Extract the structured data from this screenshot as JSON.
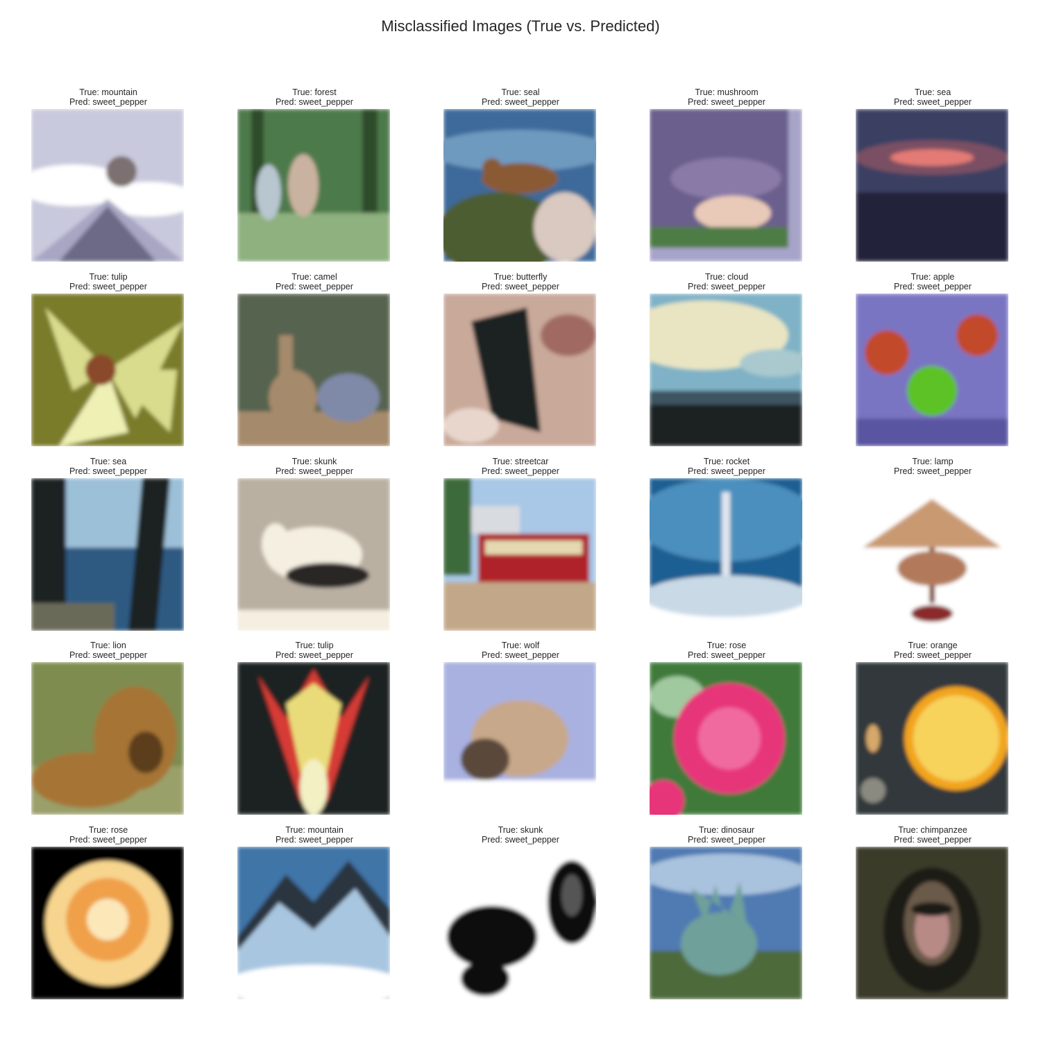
{
  "title": "Misclassified Images (True vs. Predicted)",
  "images": [
    {
      "true_label": "True: mountain",
      "pred_label": "Pred: sweet_pepper",
      "subject": "snowy-mountain-ridge",
      "palette": [
        "#c9c9dd",
        "#ffffff",
        "#6c6a86",
        "#a7a6c3"
      ]
    },
    {
      "true_label": "True: forest",
      "pred_label": "Pred: sweet_pepper",
      "subject": "people-in-forest",
      "palette": [
        "#4e7a4b",
        "#8fb07f",
        "#2f4b2c",
        "#b7c6cf"
      ]
    },
    {
      "true_label": "True: seal",
      "pred_label": "Pred: sweet_pepper",
      "subject": "seal-on-rock",
      "palette": [
        "#3d6a9a",
        "#6e9ac0",
        "#8a5a35",
        "#4d5d30"
      ]
    },
    {
      "true_label": "True: mushroom",
      "pred_label": "Pred: sweet_pepper",
      "subject": "mushroom-on-moss",
      "palette": [
        "#6b5e8d",
        "#e9c9b7",
        "#4e7b45",
        "#a7a4c9"
      ]
    },
    {
      "true_label": "True: sea",
      "pred_label": "Pred: sweet_pepper",
      "subject": "sunset-over-sea",
      "palette": [
        "#3b3f63",
        "#e47a74",
        "#22243a",
        "#7a4f64"
      ]
    },
    {
      "true_label": "True: tulip",
      "pred_label": "Pred: sweet_pepper",
      "subject": "yellow-lily-flower",
      "palette": [
        "#d9dc8c",
        "#7a7c2b",
        "#8a4a2a",
        "#eef0b4"
      ]
    },
    {
      "true_label": "True: camel",
      "pred_label": "Pred: sweet_pepper",
      "subject": "camels-in-zoo",
      "palette": [
        "#57644f",
        "#a68a6c",
        "#7f8aa8",
        "#3e4a3a"
      ]
    },
    {
      "true_label": "True: butterfly",
      "pred_label": "Pred: sweet_pepper",
      "subject": "butterfly-closeup",
      "palette": [
        "#c9a99a",
        "#1e2420",
        "#a06a62",
        "#e8d6cc"
      ]
    },
    {
      "true_label": "True: cloud",
      "pred_label": "Pred: sweet_pepper",
      "subject": "cloudy-sky-treeline",
      "palette": [
        "#e9e5c3",
        "#7fb2c6",
        "#1a2024",
        "#a9c9cf"
      ]
    },
    {
      "true_label": "True: apple",
      "pred_label": "Pred: sweet_pepper",
      "subject": "three-apples",
      "palette": [
        "#7a74c2",
        "#c24a2a",
        "#5bc226",
        "#5a55a0"
      ]
    },
    {
      "true_label": "True: sea",
      "pred_label": "Pred: sweet_pepper",
      "subject": "sea-through-trees",
      "palette": [
        "#1b2224",
        "#5a8fc0",
        "#9cc0d8",
        "#2e5a82"
      ]
    },
    {
      "true_label": "True: skunk",
      "pred_label": "Pred: sweet_pepper",
      "subject": "skunk-on-ground",
      "palette": [
        "#b9b0a2",
        "#f4efe0",
        "#2c2626",
        "#9a8f80"
      ]
    },
    {
      "true_label": "True: streetcar",
      "pred_label": "Pred: sweet_pepper",
      "subject": "red-streetcar",
      "palette": [
        "#a9c7e6",
        "#b0202a",
        "#c2a888",
        "#3d6a3a"
      ]
    },
    {
      "true_label": "True: rocket",
      "pred_label": "Pred: sweet_pepper",
      "subject": "rocket-launch",
      "palette": [
        "#1f5f92",
        "#4b8fbe",
        "#ffffff",
        "#c9d9e6"
      ]
    },
    {
      "true_label": "True: lamp",
      "pred_label": "Pred: sweet_pepper",
      "subject": "rooster-lamp",
      "palette": [
        "#ffffff",
        "#c99a72",
        "#7a3e2a",
        "#8a2a2a"
      ]
    },
    {
      "true_label": "True: lion",
      "pred_label": "Pred: sweet_pepper",
      "subject": "lion-resting",
      "palette": [
        "#7e8c4f",
        "#a67536",
        "#5c3d1c",
        "#9aa06b"
      ]
    },
    {
      "true_label": "True: tulip",
      "pred_label": "Pred: sweet_pepper",
      "subject": "red-yellow-tulip",
      "palette": [
        "#1f2422",
        "#d63a34",
        "#eadb7a",
        "#f3f0c4"
      ]
    },
    {
      "true_label": "True: wolf",
      "pred_label": "Pred: sweet_pepper",
      "subject": "wolf-in-snow",
      "palette": [
        "#a9b1e0",
        "#5a4a3a",
        "#c8a88a",
        "#ffffff"
      ]
    },
    {
      "true_label": "True: rose",
      "pred_label": "Pred: sweet_pepper",
      "subject": "pink-rose",
      "palette": [
        "#3f7a3a",
        "#e7357a",
        "#a0c9a0",
        "#f06aa0"
      ]
    },
    {
      "true_label": "True: orange",
      "pred_label": "Pred: sweet_pepper",
      "subject": "orange-slice",
      "palette": [
        "#33393a",
        "#f2a41c",
        "#f7d35c",
        "#d6a86a"
      ]
    },
    {
      "true_label": "True: rose",
      "pred_label": "Pred: sweet_pepper",
      "subject": "yellow-rose",
      "palette": [
        "#000000",
        "#f7d58f",
        "#f0a04a",
        "#fbe7b8"
      ]
    },
    {
      "true_label": "True: mountain",
      "pred_label": "Pred: sweet_pepper",
      "subject": "snowy-mountain-range",
      "palette": [
        "#3f74a8",
        "#ffffff",
        "#2c3440",
        "#a9c6e0"
      ]
    },
    {
      "true_label": "True: skunk",
      "pred_label": "Pred: sweet_pepper",
      "subject": "skunks-black-white",
      "palette": [
        "#ffffff",
        "#111111",
        "#555555",
        "#dddddd"
      ]
    },
    {
      "true_label": "True: dinosaur",
      "pred_label": "Pred: sweet_pepper",
      "subject": "dinosaur-statue",
      "palette": [
        "#4f7ab2",
        "#6fa09a",
        "#4e6a3a",
        "#a9c2de"
      ]
    },
    {
      "true_label": "True: chimpanzee",
      "pred_label": "Pred: sweet_pepper",
      "subject": "chimpanzee-face",
      "palette": [
        "#3a3a2a",
        "#6a5a4a",
        "#b78a86",
        "#1e1a18"
      ]
    }
  ]
}
